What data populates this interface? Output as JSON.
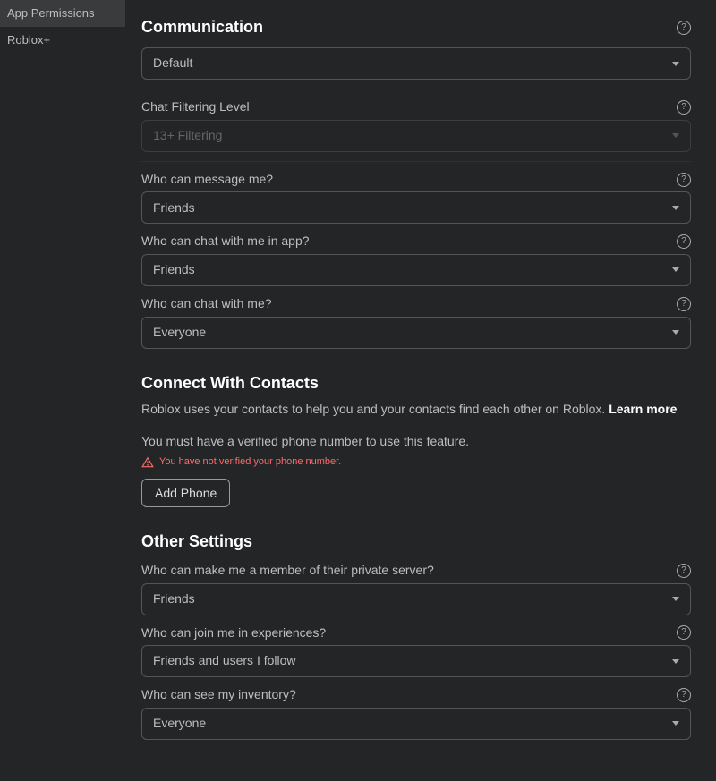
{
  "sidebar": {
    "items": [
      {
        "label": "App Permissions"
      },
      {
        "label": "Roblox+"
      }
    ]
  },
  "sections": {
    "communication": {
      "title": "Communication",
      "settings": [
        {
          "label": "",
          "value": "Default"
        },
        {
          "label": "Chat Filtering Level",
          "value": "13+ Filtering",
          "disabled": true
        },
        {
          "label": "Who can message me?",
          "value": "Friends"
        },
        {
          "label": "Who can chat with me in app?",
          "value": "Friends"
        },
        {
          "label": "Who can chat with me?",
          "value": "Everyone"
        }
      ]
    },
    "connect": {
      "title": "Connect With Contacts",
      "desc": "Roblox uses your contacts to help you and your contacts find each other on Roblox. ",
      "learn_more": "Learn more",
      "requirement": "You must have a verified phone number to use this feature.",
      "warning": "You have not verified your phone number.",
      "button": "Add Phone"
    },
    "other": {
      "title": "Other Settings",
      "settings": [
        {
          "label": "Who can make me a member of their private server?",
          "value": "Friends"
        },
        {
          "label": "Who can join me in experiences?",
          "value": "Friends and users I follow"
        },
        {
          "label": "Who can see my inventory?",
          "value": "Everyone"
        }
      ]
    }
  }
}
